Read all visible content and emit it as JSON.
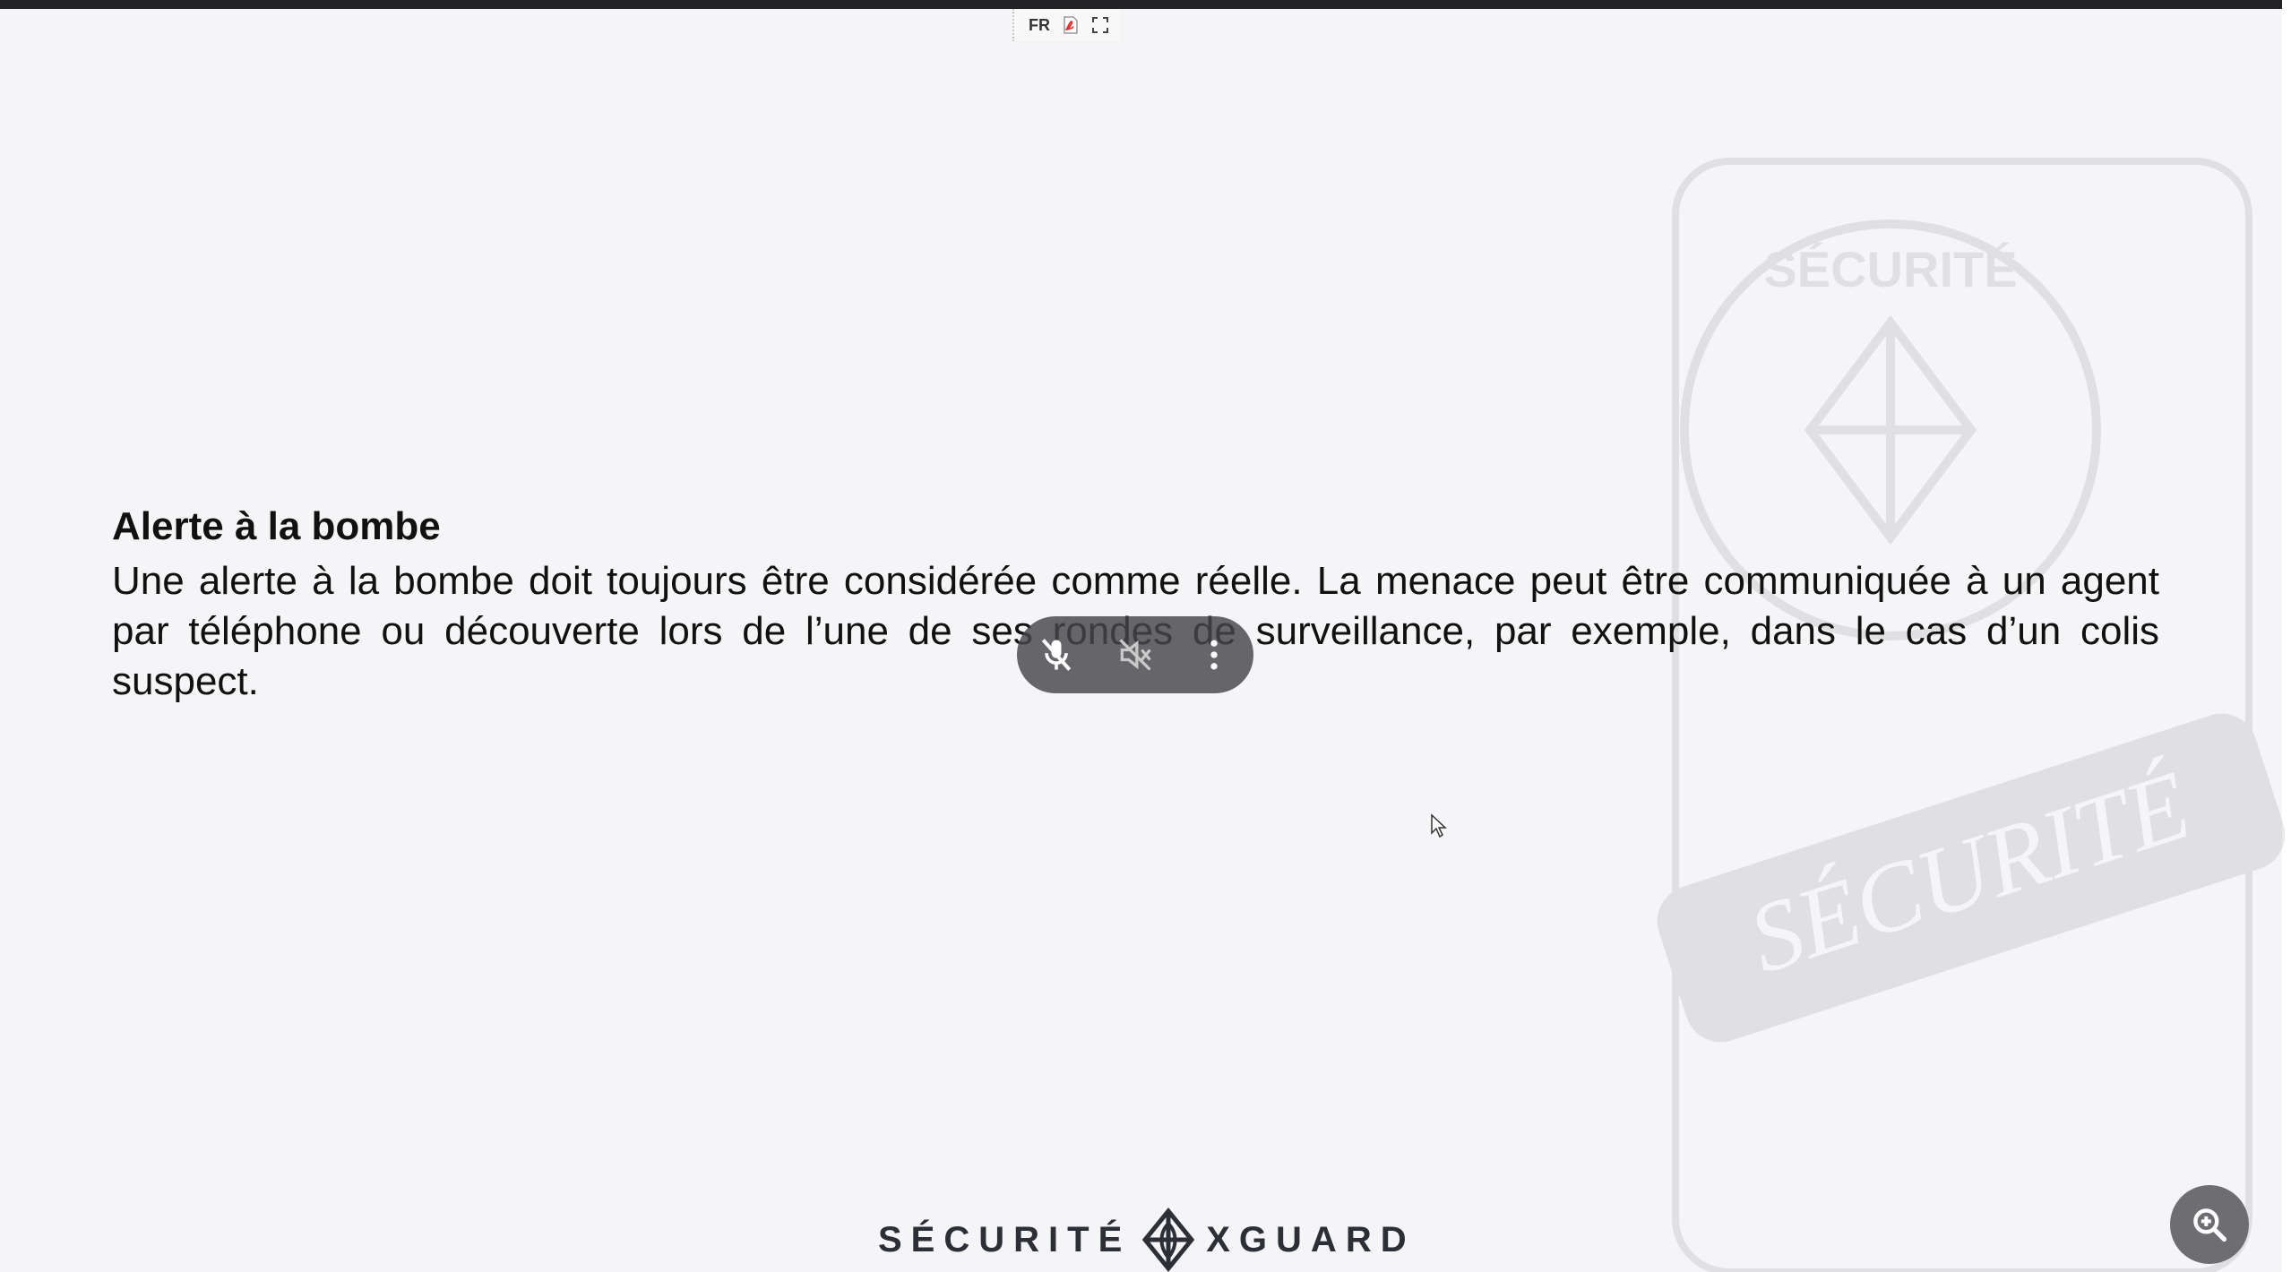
{
  "toolbar": {
    "language": "FR",
    "pdf_icon": "pdf-icon",
    "fullscreen_icon": "fullscreen-icon"
  },
  "slide": {
    "heading": "Alerte à la bombe",
    "paragraph": "Une alerte à la bombe doit toujours être considérée comme réelle. La menace peut être communiquée à un agent par téléphone ou découverte lors de l’une de ses rondes de surveillance, par exemple, dans le cas d’un colis suspect."
  },
  "media_controls": {
    "mic_icon": "mic-off-icon",
    "speaker_icon": "speaker-off-icon",
    "more_icon": "more-vertical-icon"
  },
  "watermark": {
    "word_top": "SÉCURITÉ",
    "word_bottom": "SÉCURITÉ"
  },
  "logo": {
    "left_word": "SÉCURITÉ",
    "right_word": "XGUARD"
  },
  "zoom": {
    "icon": "zoom-in-icon"
  },
  "colors": {
    "background": "#f5f5f7",
    "text": "#111111",
    "pill": "#46464a",
    "zoom_button": "#6d6d72",
    "logo": "#2c2f36"
  }
}
